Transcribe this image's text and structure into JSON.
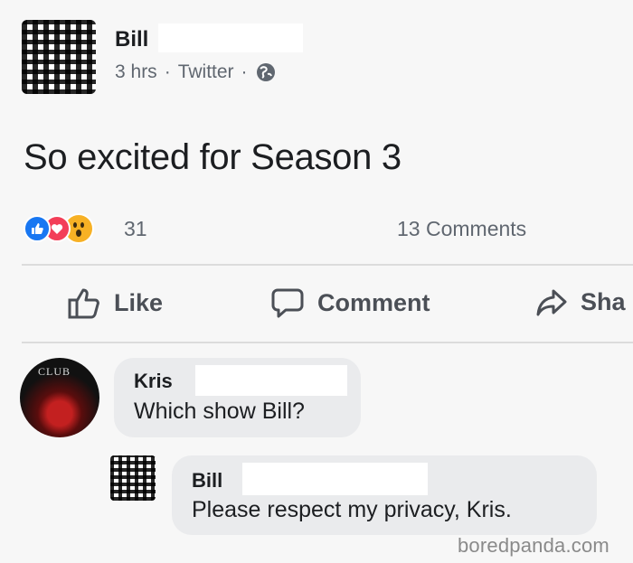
{
  "post": {
    "author": "Bill",
    "time": "3 hrs",
    "separator": "·",
    "source": "Twitter",
    "audience_icon": "globe-icon",
    "text": "So excited for Season 3"
  },
  "reactions": {
    "icons": [
      "like-icon",
      "love-icon",
      "wow-icon"
    ],
    "count": "31",
    "comments_label": "13 Comments"
  },
  "actions": {
    "like": "Like",
    "comment": "Comment",
    "share": "Sha"
  },
  "comments": [
    {
      "author": "Kris",
      "text": "Which show Bill?",
      "avatar_text": "CLUB"
    },
    {
      "author": "Bill",
      "text": "Please respect my privacy, Kris."
    }
  ],
  "watermark": "boredpanda.com",
  "colors": {
    "like": "#1877f2",
    "love": "#f33e58",
    "wow": "#f7b125",
    "bubble": "#eaebed",
    "meta_text": "#606770"
  }
}
